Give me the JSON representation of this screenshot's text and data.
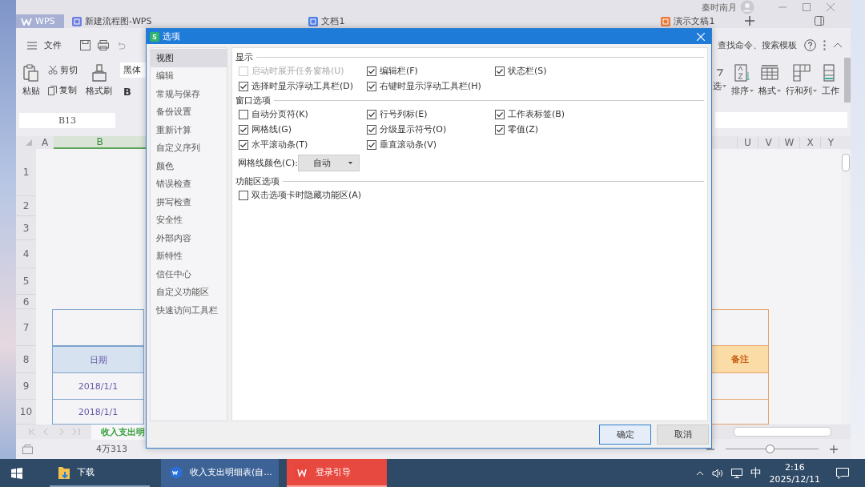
{
  "user": {
    "name": "秦时南月"
  },
  "tabs": [
    {
      "label": "WPS",
      "kind": "home",
      "selected": false
    },
    {
      "label": "新建流程图-WPS",
      "kind": "doc",
      "selected": false
    },
    {
      "label": "文档1",
      "kind": "doc",
      "selected": false
    },
    {
      "label": "演示文稿1",
      "kind": "doc",
      "selected": false
    }
  ],
  "menu": {
    "file": "文件",
    "search": "查找命令、搜索模板"
  },
  "ribbon": {
    "paste": "粘贴",
    "cut": "剪切",
    "copy": "复制",
    "painter": "格式刷",
    "font": "黑体",
    "bold": "B",
    "right": [
      {
        "label": "选",
        "kind": "filter"
      },
      {
        "label": "排序",
        "kind": "sort"
      },
      {
        "label": "格式",
        "kind": "format"
      },
      {
        "label": "行和列",
        "kind": "rowcol"
      },
      {
        "label": "工作",
        "kind": "sheet"
      }
    ]
  },
  "name_box": "B13",
  "columns_left": [
    "A",
    "B"
  ],
  "columns_right": [
    "U",
    "V",
    "W",
    "X",
    "Y"
  ],
  "rows": [
    {
      "number": "1",
      "kind": "blank"
    },
    {
      "number": "2",
      "kind": "blank"
    },
    {
      "number": "3",
      "kind": "blank"
    },
    {
      "number": "4",
      "kind": "blank"
    },
    {
      "number": "5",
      "kind": "blank"
    },
    {
      "number": "6",
      "kind": "blank"
    },
    {
      "number": "7",
      "kind": "title"
    },
    {
      "number": "8",
      "kind": "header",
      "left": "日期",
      "right": "备注"
    },
    {
      "number": "9",
      "kind": "data",
      "left": "2018/1/1"
    },
    {
      "number": "10",
      "kind": "data",
      "left": "2018/1/1"
    }
  ],
  "sheet_tab": "收入支出明",
  "status": {
    "count": "4万313",
    "zoom_slider": {
      "level": 0.48
    }
  },
  "dialog": {
    "title": "选项",
    "nav": [
      {
        "label": "视图",
        "selected": true
      },
      {
        "label": "编辑",
        "selected": false
      },
      {
        "label": "常规与保存",
        "selected": false
      },
      {
        "label": "备份设置",
        "selected": false
      },
      {
        "label": "重新计算",
        "selected": false
      },
      {
        "label": "自定义序列",
        "selected": false
      },
      {
        "label": "颜色",
        "selected": false
      },
      {
        "label": "错误检查",
        "selected": false
      },
      {
        "label": "拼写检查",
        "selected": false
      },
      {
        "label": "安全性",
        "selected": false
      },
      {
        "label": "外部内容",
        "selected": false
      },
      {
        "label": "新特性",
        "selected": false
      },
      {
        "label": "信任中心",
        "selected": false
      },
      {
        "label": "自定义功能区",
        "selected": false
      },
      {
        "label": "快速访问工具栏",
        "selected": false
      }
    ],
    "sections": [
      {
        "title": "显示",
        "items": [
          {
            "label": "启动时展开任务窗格(U)",
            "checked": false,
            "disabled": true
          },
          {
            "label": "编辑栏(F)",
            "checked": true,
            "disabled": false
          },
          {
            "label": "状态栏(S)",
            "checked": true,
            "disabled": false
          },
          {
            "label": "选择时显示浮动工具栏(D)",
            "checked": true,
            "disabled": false
          },
          {
            "label": "右键时显示浮动工具栏(H)",
            "checked": true,
            "disabled": false
          }
        ]
      },
      {
        "title": "窗口选项",
        "items": [
          {
            "label": "自动分页符(K)",
            "checked": false,
            "disabled": false
          },
          {
            "label": "行号列标(E)",
            "checked": true,
            "disabled": false
          },
          {
            "label": "工作表标签(B)",
            "checked": true,
            "disabled": false
          },
          {
            "label": "网格线(G)",
            "checked": true,
            "disabled": false
          },
          {
            "label": "分级显示符号(O)",
            "checked": true,
            "disabled": false
          },
          {
            "label": "零值(Z)",
            "checked": true,
            "disabled": false
          },
          {
            "label": "水平滚动条(T)",
            "checked": true,
            "disabled": false
          },
          {
            "label": "垂直滚动条(V)",
            "checked": true,
            "disabled": false
          }
        ],
        "select": {
          "label": "网格线颜色(C):",
          "value": "自动"
        }
      },
      {
        "title": "功能区选项",
        "items": [
          {
            "label": "双击选项卡时隐藏功能区(A)",
            "checked": false,
            "disabled": false
          }
        ]
      }
    ],
    "buttons": [
      {
        "label": "确定",
        "kind": "primary"
      },
      {
        "label": "取消",
        "kind": "secondary"
      }
    ]
  },
  "taskbar": {
    "items": [
      {
        "label": "下载",
        "kind": "folder",
        "selected": false
      },
      {
        "label": "收入支出明细表(自...",
        "kind": "wps",
        "selected": true
      },
      {
        "label": "登录引导",
        "kind": "login",
        "selected": false
      }
    ],
    "ime": "中",
    "time": "2:16",
    "date": "2025/12/11"
  }
}
